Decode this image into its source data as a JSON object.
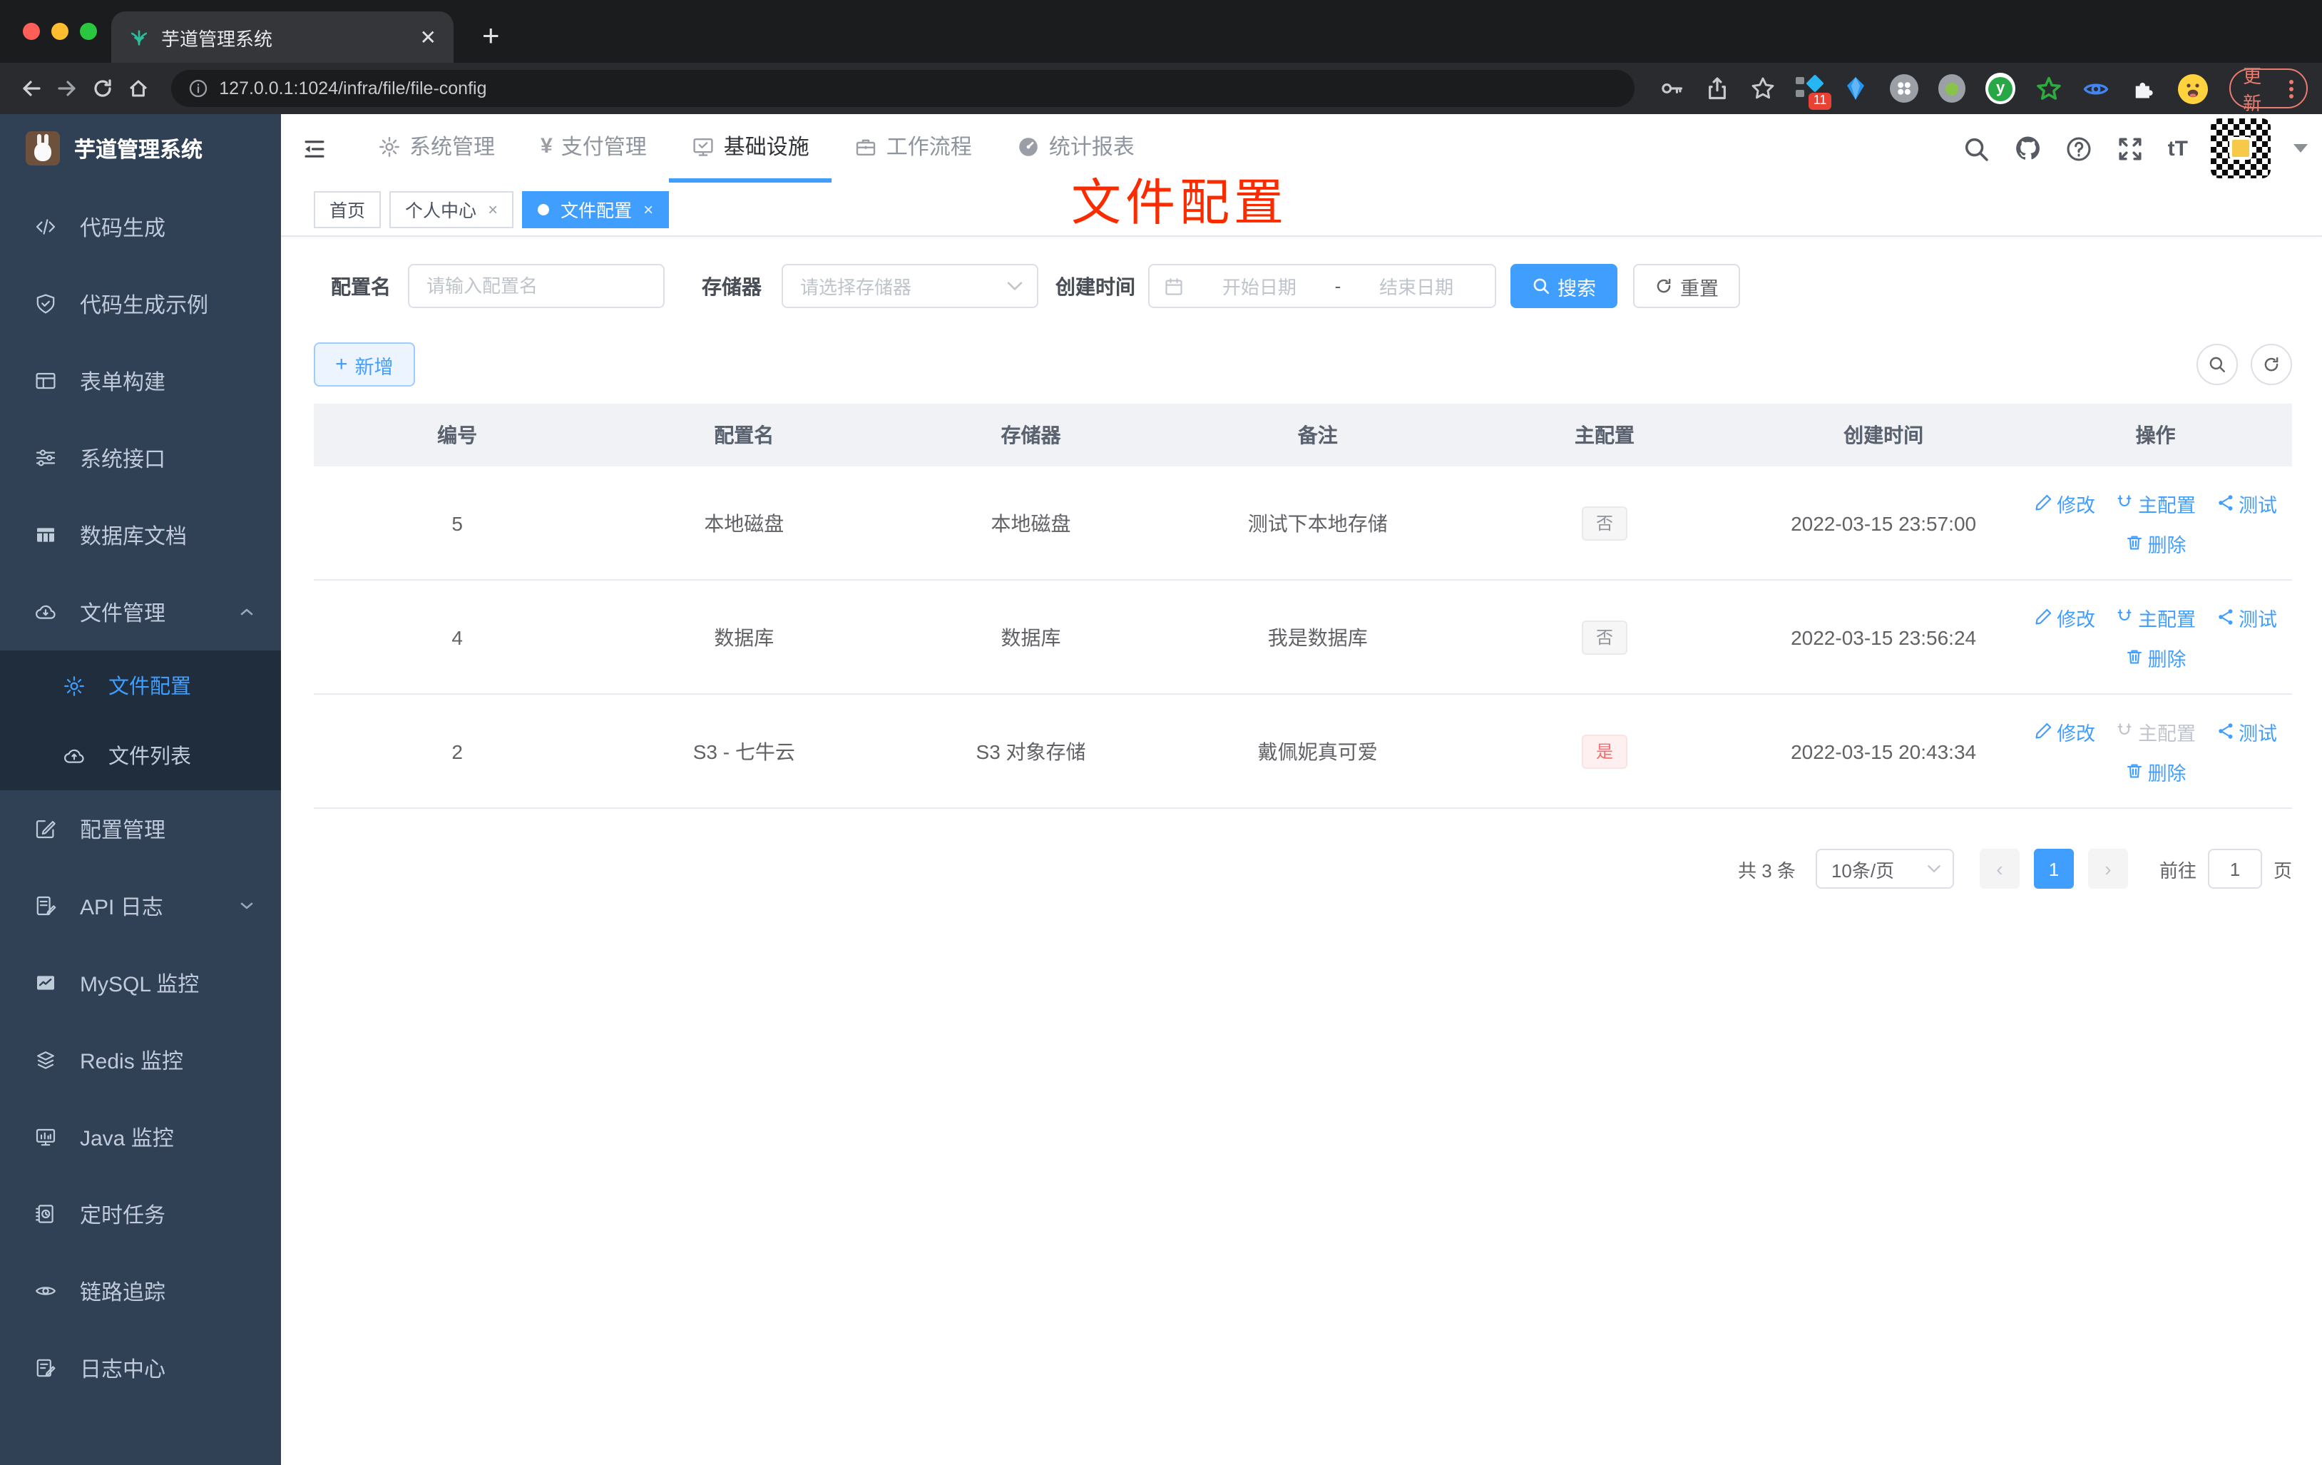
{
  "browser": {
    "tab_title": "芋道管理系统",
    "url": "127.0.0.1:1024/infra/file/file-config",
    "update_label": "更新",
    "extension_badge": "11"
  },
  "logo": {
    "title": "芋道管理系统"
  },
  "topnav": {
    "items": [
      {
        "label": "系统管理"
      },
      {
        "label": "支付管理"
      },
      {
        "label": "基础设施"
      },
      {
        "label": "工作流程"
      },
      {
        "label": "统计报表"
      }
    ],
    "font_size_label": "tT"
  },
  "sidebar": {
    "items": [
      {
        "label": "代码生成",
        "icon": "code-icon"
      },
      {
        "label": "代码生成示例",
        "icon": "shield-check-icon"
      },
      {
        "label": "表单构建",
        "icon": "form-icon"
      },
      {
        "label": "系统接口",
        "icon": "sliders-icon"
      },
      {
        "label": "数据库文档",
        "icon": "table-grid-icon"
      },
      {
        "label": "文件管理",
        "icon": "cloud-download-icon"
      },
      {
        "label": "文件配置",
        "icon": "gear-icon"
      },
      {
        "label": "文件列表",
        "icon": "cloud-upload-icon"
      },
      {
        "label": "配置管理",
        "icon": "edit-square-icon"
      },
      {
        "label": "API 日志",
        "icon": "document-edit-icon"
      },
      {
        "label": "MySQL 监控",
        "icon": "chart-icon"
      },
      {
        "label": "Redis 监控",
        "icon": "layers-icon"
      },
      {
        "label": "Java 监控",
        "icon": "monitor-icon"
      },
      {
        "label": "定时任务",
        "icon": "schedule-icon"
      },
      {
        "label": "链路追踪",
        "icon": "eye-icon"
      },
      {
        "label": "日志中心",
        "icon": "log-edit-icon"
      }
    ]
  },
  "tabs": [
    {
      "label": "首页"
    },
    {
      "label": "个人中心"
    },
    {
      "label": "文件配置"
    }
  ],
  "annotation": {
    "text": "文件配置",
    "color": "#fb2b00"
  },
  "filters": {
    "name_label": "配置名",
    "name_placeholder": "请输入配置名",
    "storage_label": "存储器",
    "storage_placeholder": "请选择存储器",
    "time_label": "创建时间",
    "start_placeholder": "开始日期",
    "separator": "-",
    "end_placeholder": "结束日期",
    "search_label": "搜索",
    "reset_label": "重置"
  },
  "toolbar": {
    "add_label": "新增"
  },
  "table": {
    "headers": [
      "编号",
      "配置名",
      "存储器",
      "备注",
      "主配置",
      "创建时间",
      "操作"
    ],
    "actions": {
      "edit": "修改",
      "primary": "主配置",
      "test": "测试",
      "delete": "删除"
    },
    "rows": [
      {
        "id": "5",
        "name": "本地磁盘",
        "storage": "本地磁盘",
        "remark": "测试下本地存储",
        "primary": "否",
        "created": "2022-03-15 23:57:00"
      },
      {
        "id": "4",
        "name": "数据库",
        "storage": "数据库",
        "remark": "我是数据库",
        "primary": "否",
        "created": "2022-03-15 23:56:24"
      },
      {
        "id": "2",
        "name": "S3 - 七牛云",
        "storage": "S3 对象存储",
        "remark": "戴佩妮真可爱",
        "primary": "是",
        "created": "2022-03-15 20:43:34"
      }
    ]
  },
  "pagination": {
    "total": "共 3 条",
    "page_size": "10条/页",
    "current_page": "1",
    "goto_label": "前往",
    "goto_value": "1",
    "page_unit": "页"
  },
  "colors": {
    "accent": "#409eff",
    "danger": "#f56c6c",
    "annotation_red": "#fb2b00",
    "sidebar_bg": "#304156",
    "submenu_bg": "#1f2d3d"
  }
}
